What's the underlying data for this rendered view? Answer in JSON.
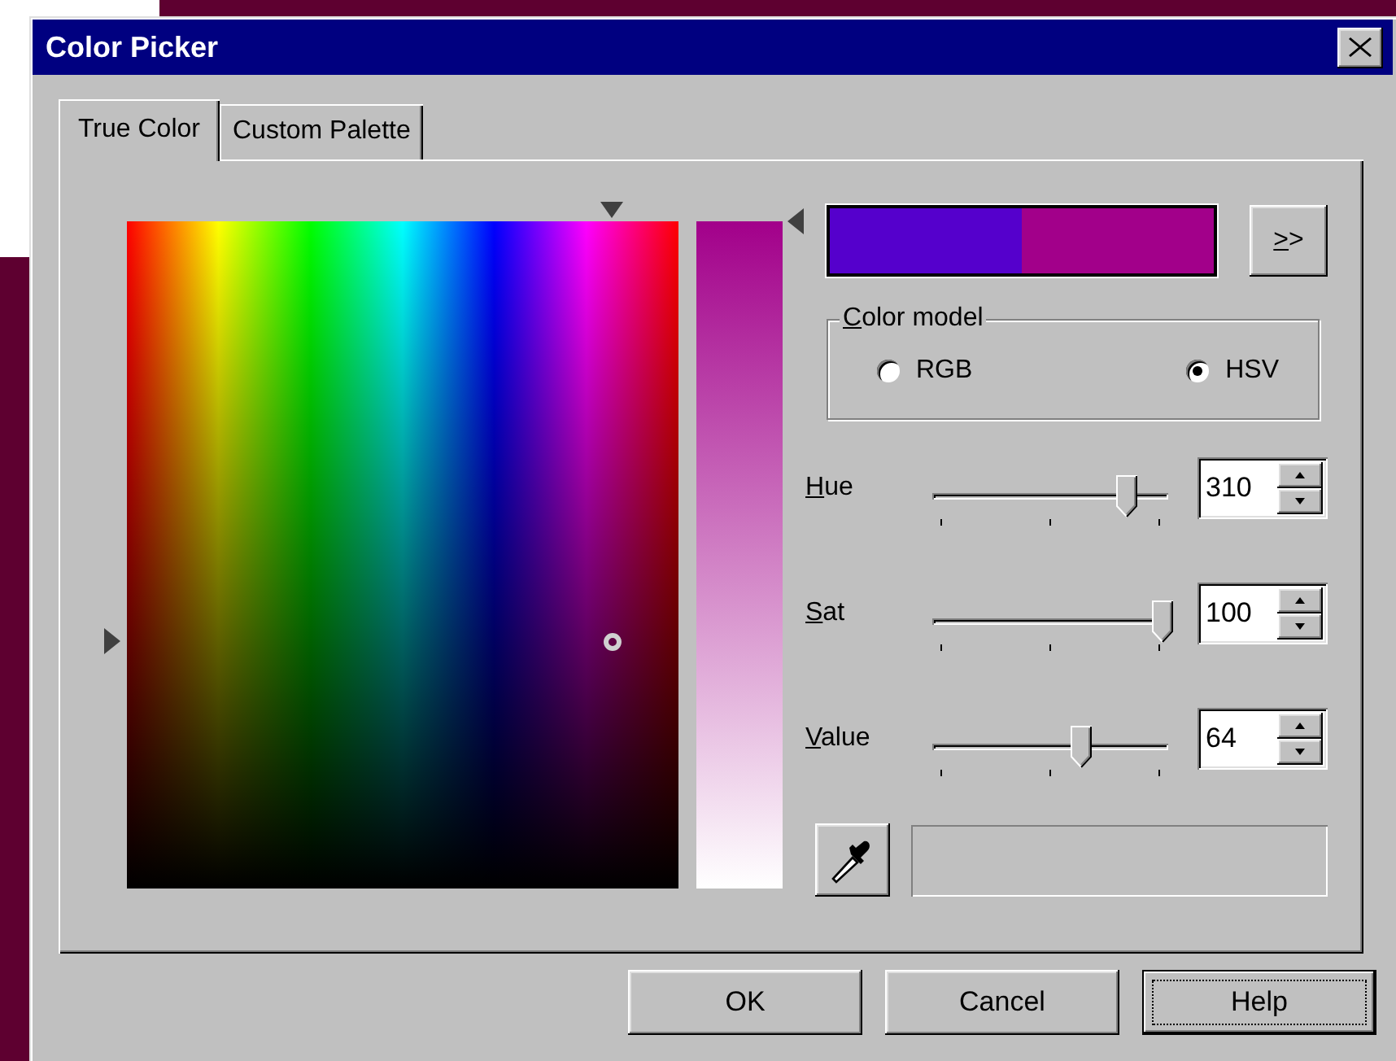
{
  "window": {
    "title": "Color Picker"
  },
  "tabs": [
    {
      "label": "True Color",
      "selected": true
    },
    {
      "label": "Custom Palette",
      "selected": false
    }
  ],
  "preview": [
    {
      "color": "#5500cc"
    },
    {
      "color": "#a2008a"
    }
  ],
  "more_button": {
    "label": ">>",
    "underline_first": true
  },
  "color_model": {
    "label": "Color model",
    "underline_first": true,
    "options": [
      {
        "label": "RGB",
        "selected": false
      },
      {
        "label": "HSV",
        "selected": true
      }
    ]
  },
  "sliders": [
    {
      "label": "Hue",
      "underline_first": true,
      "level": 0.84,
      "value": "310"
    },
    {
      "label": "Sat",
      "underline_first": true,
      "level": 1.0,
      "value": "100"
    },
    {
      "label": "Value",
      "underline_first": true,
      "level": 0.64,
      "value": "64"
    }
  ],
  "buttons": [
    {
      "label": "OK",
      "default": false
    },
    {
      "label": "Cancel",
      "default": false
    },
    {
      "label": "Help",
      "default": true
    }
  ]
}
